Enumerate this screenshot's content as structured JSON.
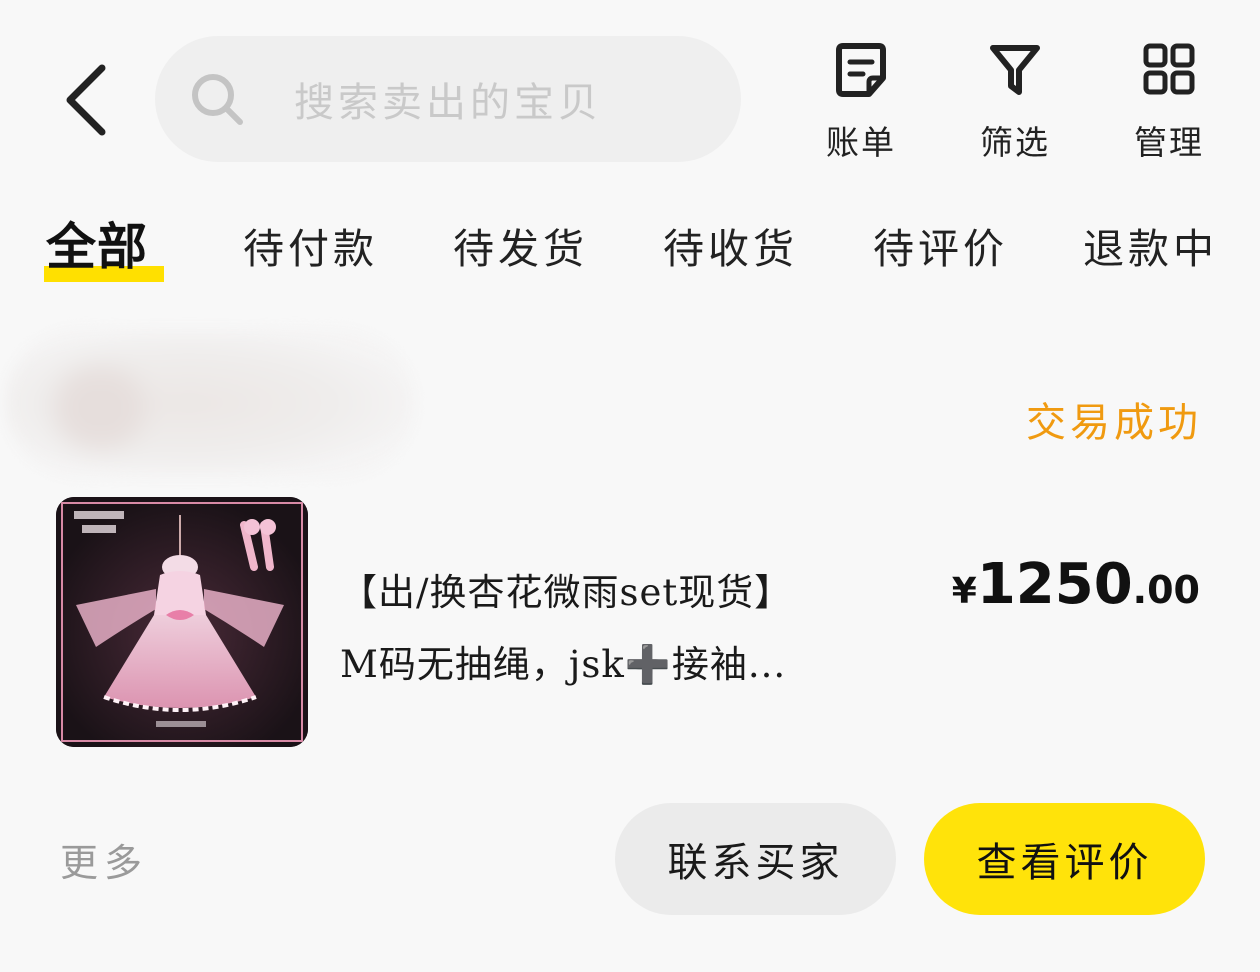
{
  "header": {
    "search_placeholder": "搜索卖出的宝贝",
    "actions": [
      {
        "label": "账单",
        "icon": "bill-icon"
      },
      {
        "label": "筛选",
        "icon": "filter-icon"
      },
      {
        "label": "管理",
        "icon": "grid-icon"
      }
    ]
  },
  "tabs": [
    "全部",
    "待付款",
    "待发货",
    "待收货",
    "待评价",
    "退款中"
  ],
  "active_tab": "全部",
  "order": {
    "status": "交易成功",
    "title_line1": "【出/换杏花微雨set现货】",
    "title_line2": "M码无抽绳，jsk➕接袖...",
    "price_currency": "¥",
    "price_integer": "1250",
    "price_decimal": ".00",
    "more_label": "更多",
    "contact_button": "联系买家",
    "review_button": "查看评价"
  },
  "colors": {
    "accent_yellow": "#ffe30a",
    "status_orange": "#f09a10",
    "background": "#f8f8f8"
  }
}
